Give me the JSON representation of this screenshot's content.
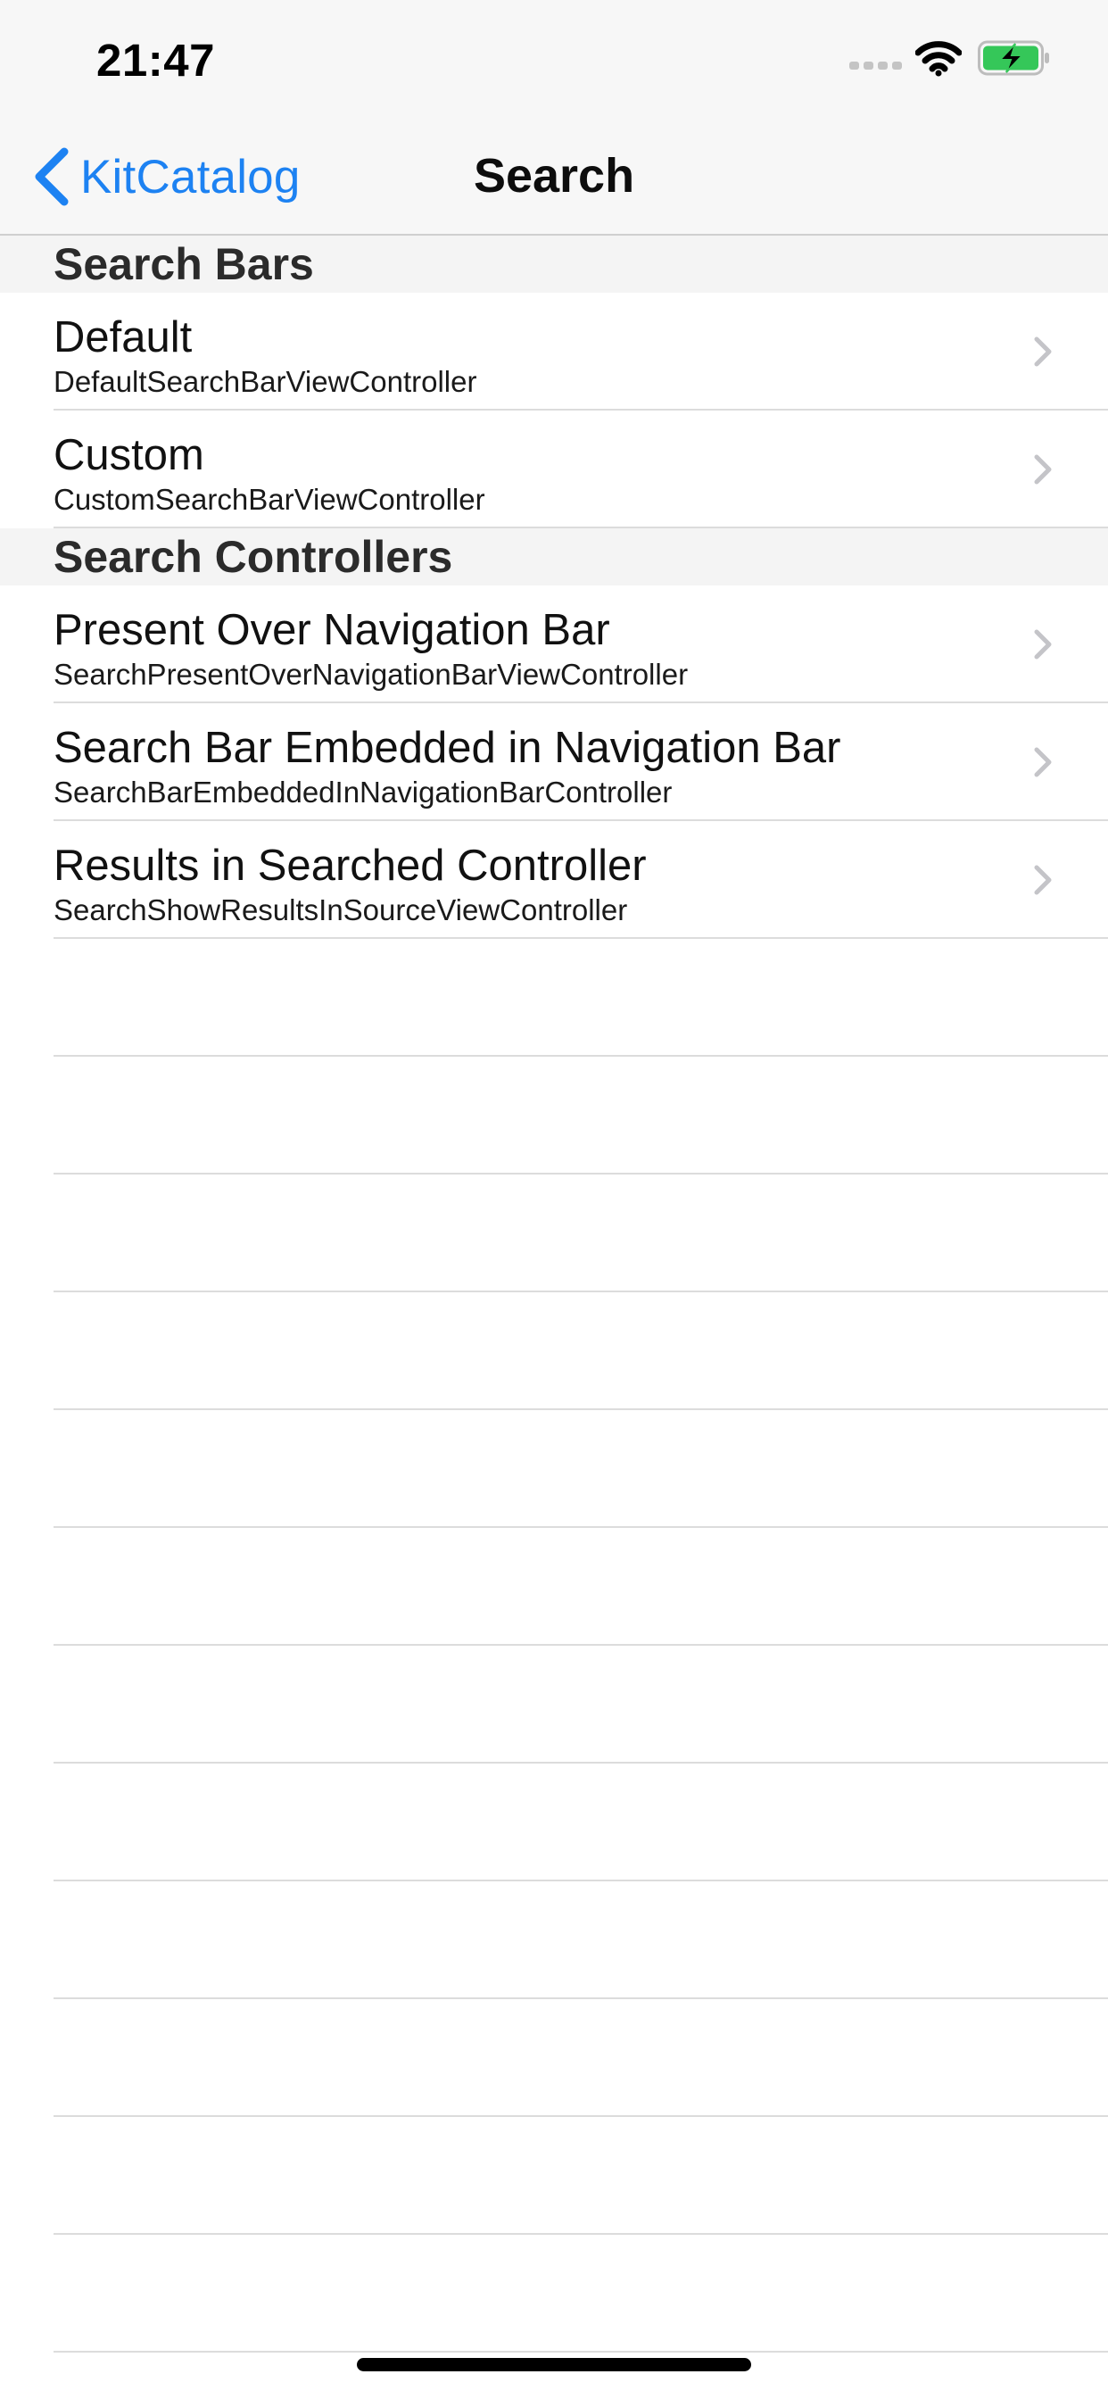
{
  "status_bar": {
    "time": "21:47",
    "icons": [
      "signal-icon",
      "wifi-icon",
      "battery-charging-icon"
    ],
    "battery_color": "#35c759"
  },
  "nav": {
    "back_label": "KitCatalog",
    "title": "Search",
    "accent": "#1d82f2"
  },
  "sections": [
    {
      "title": "Search Bars",
      "rows": [
        {
          "title": "Default",
          "subtitle": "DefaultSearchBarViewController"
        },
        {
          "title": "Custom",
          "subtitle": "CustomSearchBarViewController"
        }
      ]
    },
    {
      "title": "Search Controllers",
      "rows": [
        {
          "title": "Present Over Navigation Bar",
          "subtitle": "SearchPresentOverNavigationBarViewController"
        },
        {
          "title": "Search Bar Embedded in Navigation Bar",
          "subtitle": "SearchBarEmbeddedInNavigationBarController"
        },
        {
          "title": "Results in Searched Controller",
          "subtitle": "SearchShowResultsInSourceViewController"
        }
      ]
    }
  ]
}
